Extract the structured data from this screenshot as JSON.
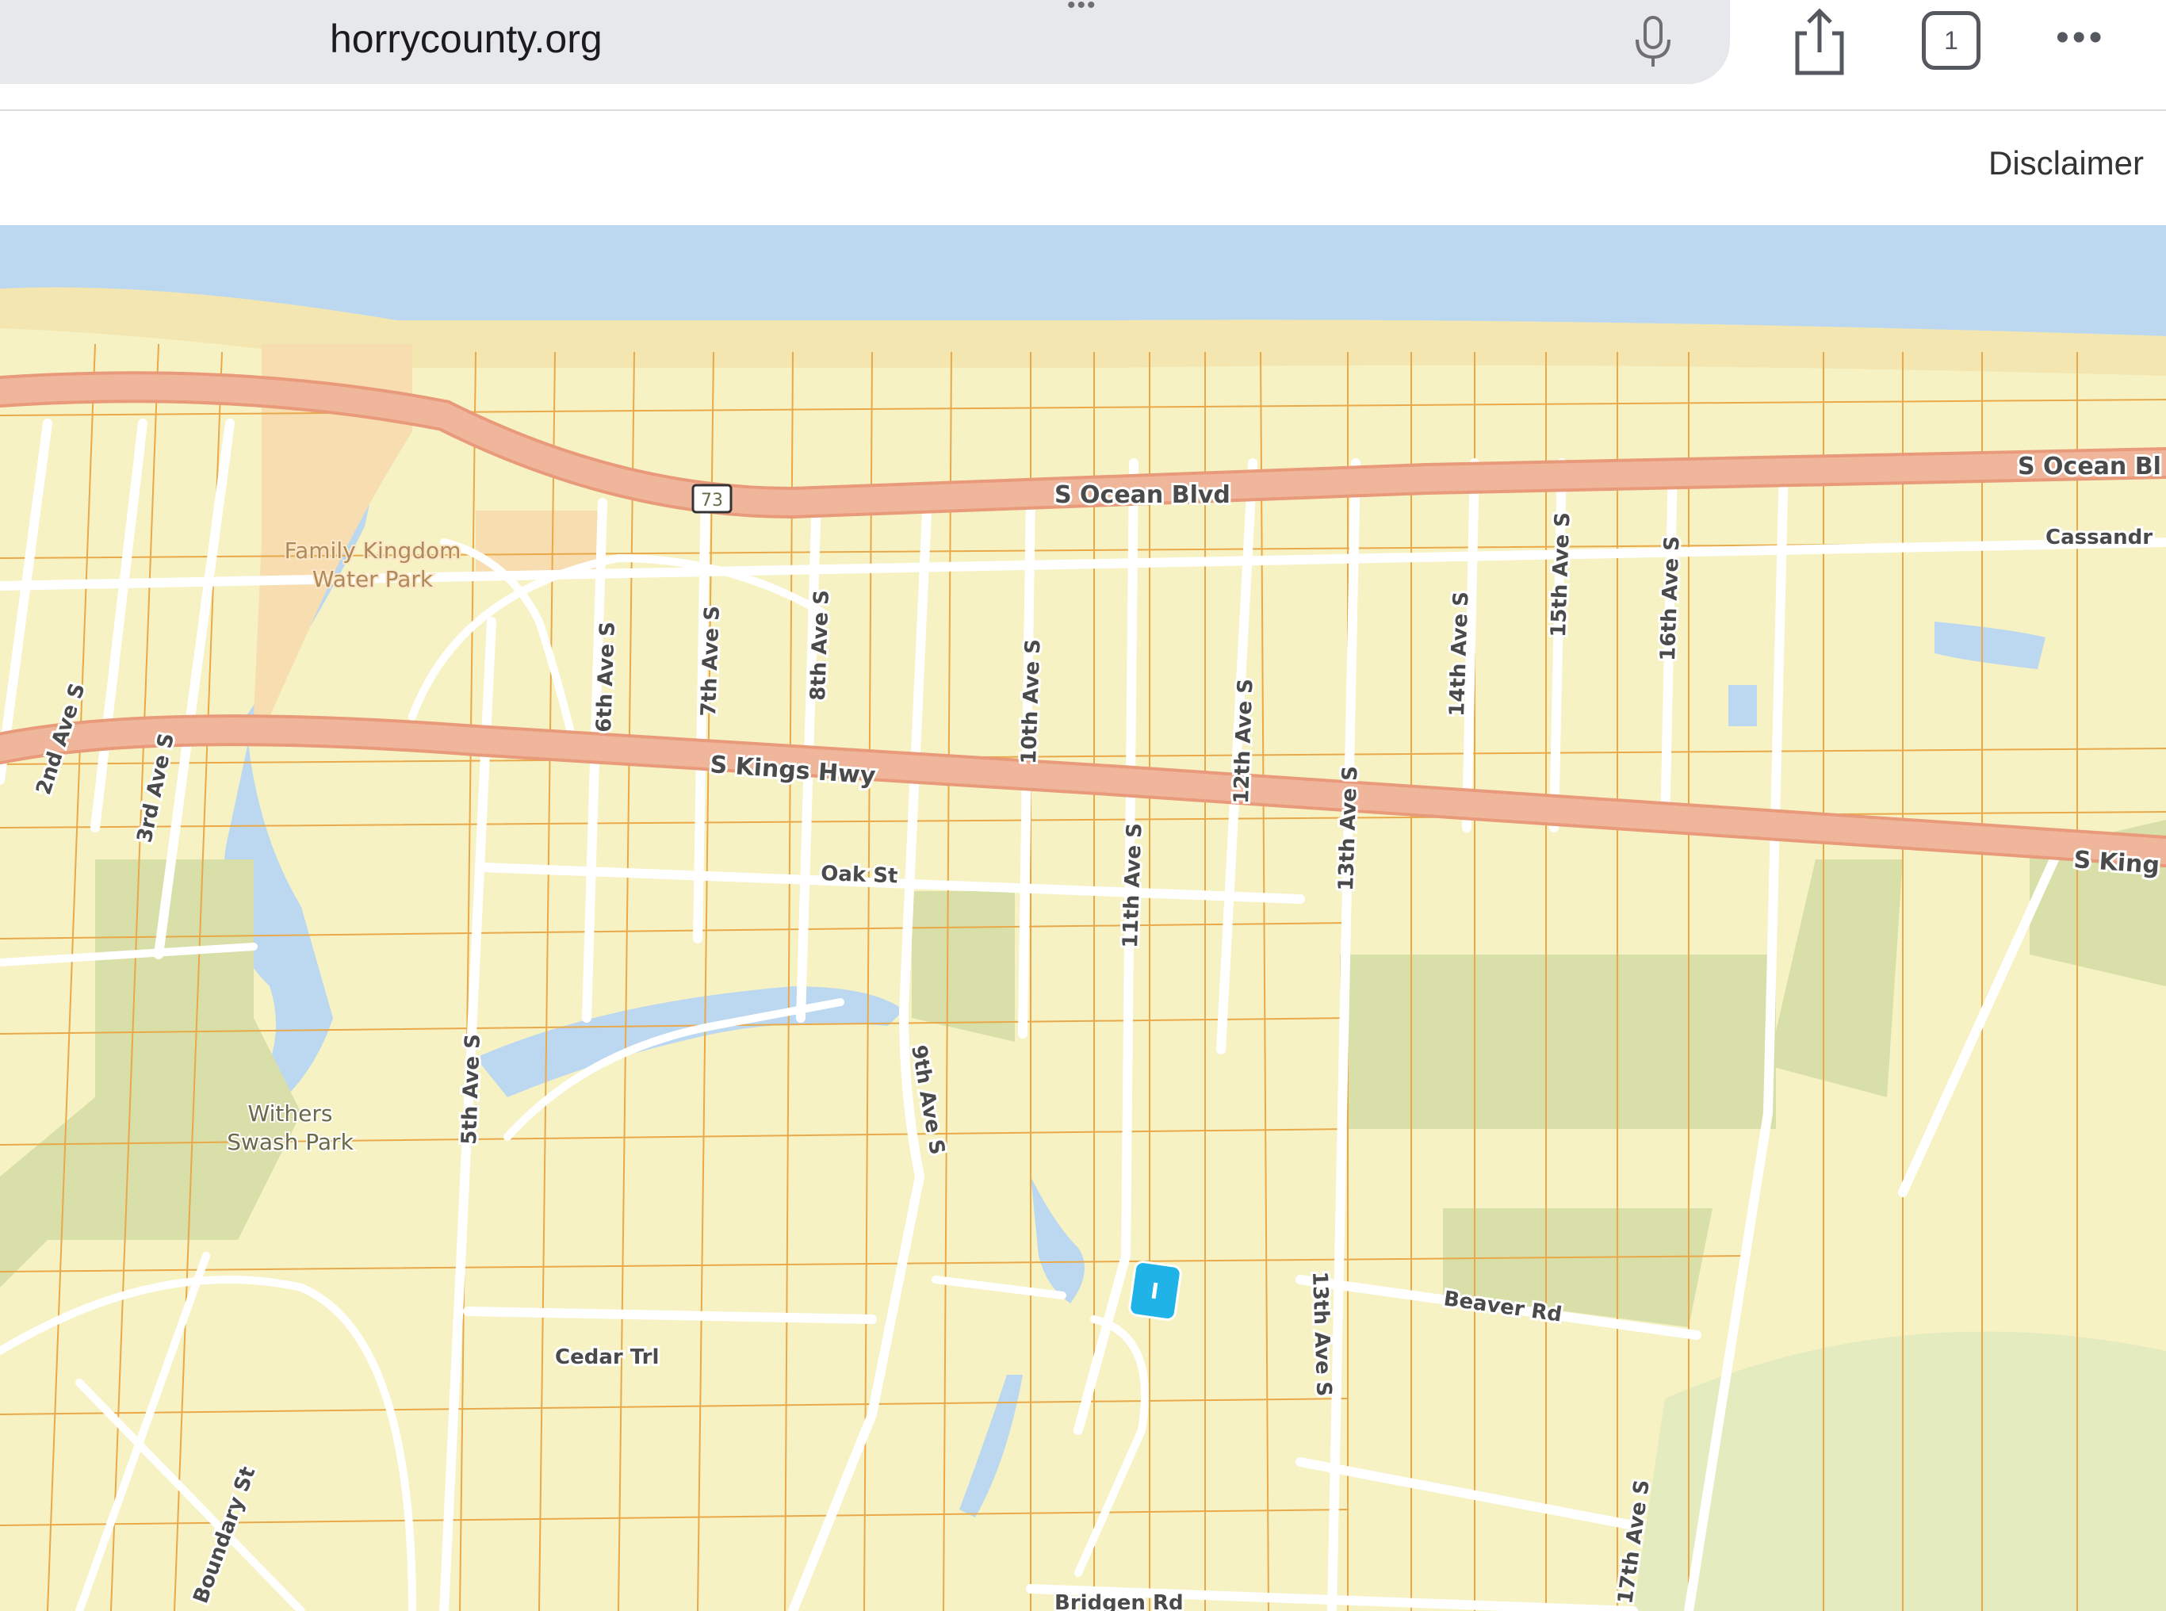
{
  "browser": {
    "url": "horrycounty.org",
    "grip": "•••",
    "tab_count": "1",
    "more": "•••"
  },
  "toolbar": {
    "disclaimer": "Disclaimer"
  },
  "map": {
    "colors": {
      "land": "#f6f2c4",
      "water": "#bcd8f0",
      "beach": "#f3e6b0",
      "park": "#d9dfa8",
      "waterpark": "#f7ddb0",
      "highway": "#f0b69c",
      "parcel": "#e9a94a",
      "marker": "#1fb3e8"
    },
    "roads": {
      "s_ocean_blvd": "S Ocean Blvd",
      "s_ocean_blvd_right": "S Ocean Bl",
      "s_kings_hwy": "S Kings Hwy",
      "s_kings_hwy_right": "S King",
      "route_shield": "73",
      "oak_st": "Oak St",
      "cedar_trl": "Cedar Trl",
      "beaver_rd": "Beaver Rd",
      "bridgen_rd": "Bridgen Rd",
      "boundary_st": "Boundary St",
      "cassandra": "Cassandr",
      "ave_2nd": "2nd Ave S",
      "ave_3rd": "3rd Ave S",
      "ave_5th": "5th Ave S",
      "ave_6th": "6th Ave S",
      "ave_7th": "7th Ave S",
      "ave_8th": "8th Ave S",
      "ave_9th": "9th Ave S",
      "ave_10th": "10th Ave S",
      "ave_11th": "11th Ave S",
      "ave_12th": "12th Ave S",
      "ave_13th": "13th Ave S",
      "ave_13th_lower": "13th Ave S",
      "ave_14th": "14th Ave S",
      "ave_15th": "15th Ave S",
      "ave_16th": "16th Ave S",
      "ave_17th": "17th Ave S"
    },
    "places": {
      "family_kingdom_1": "Family Kingdom",
      "family_kingdom_2": "Water Park",
      "withers_1": "Withers",
      "withers_2": "Swash Park"
    },
    "marker_icon": "selected-parcel-marker"
  }
}
